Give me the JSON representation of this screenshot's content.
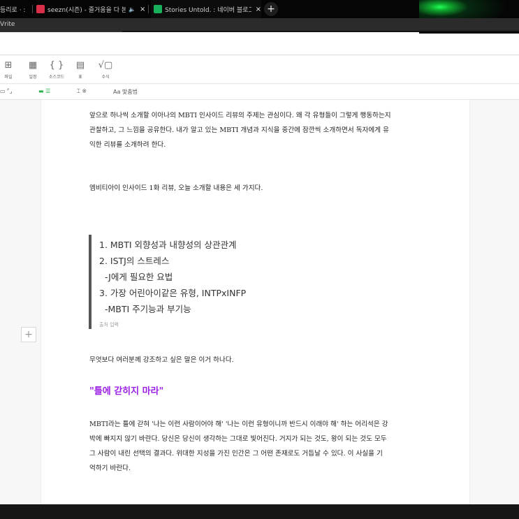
{
  "browser": {
    "tabs": [
      {
        "label": "등리로 · :",
        "favicon_color": "#2e7d32"
      },
      {
        "label": "seezn(시즌) - 즐거움을 다 본",
        "favicon_color": "#d9304a",
        "audio": "🔈"
      },
      {
        "label": "Stories Untold. : 네이버 블로그",
        "favicon_color": "#18b05a"
      }
    ],
    "new_tab": "+",
    "close": "×"
  },
  "app": {
    "title": "Vrite"
  },
  "toolbar": {
    "items": [
      {
        "label": "파일",
        "icon": "⊞"
      },
      {
        "label": "일정",
        "icon": "▦"
      },
      {
        "label": "소스코드",
        "icon": "{ }"
      },
      {
        "label": "표",
        "icon": "▤"
      },
      {
        "label": "수식",
        "icon": "√▢"
      }
    ]
  },
  "format_bar": {
    "items": [
      "▭ ⌜⌟",
      "▬ ☰",
      "⌶ ※"
    ],
    "spellcheck_label": "맞춤법"
  },
  "document": {
    "intro_lines": [
      "앞으로 하나씩 소개할 이아나의 MBTI 인사이드 리뷰의 주제는 관심이다. 왜 각 유형들이 그렇게 행동하는지",
      "관찰하고, 그 느낌을 공유한다. 내가 알고 있는 MBTI 개념과 지식을 중간에 잠깐씩 소개하면서 독자에게 유",
      "익한 리뷰를 소개하려 한다."
    ],
    "topic_line": "엠비티아이 인사이드 1화 리뷰, 오늘 소개할 내용은 세 가지다.",
    "quote_lines": [
      "1. MBTI 외향성과 내향성의 상관관계",
      "2. ISTJ의 스트레스",
      "  -J에게 필요한 요법",
      "3. 가장 어린아이같은 유형, INTPxINFP",
      "  -MBTI 주기능과 부기능"
    ],
    "quote_caption": "출처 입력",
    "emphasis_line": "무엇보다 여러분께 강조하고 싶은 말은 이거 하나다.",
    "highlight": "\"틀에 갇히지 마라\"",
    "highlight_color": "#9b1fe8",
    "closing_lines": [
      "MBTI라는 틀에 갇혀 '나는 이런 사람이어야 해' '나는 이런 유형이니까 반드시 이래야 해' 하는 어리석은 강",
      "박에 빠지지 않기 바란다. 당신은 당신이 생각하는 그대로 빛어진다. 거지가 되는 것도, 왕이 되는 것도 모두",
      "그 사람이 내린 선택의 결과다. 위대한 지성을 가진 인간은 그 어떤 존재로도 거듭날 수 있다.  이 사실을 기",
      "억하기 바란다."
    ],
    "add_block": "+"
  }
}
